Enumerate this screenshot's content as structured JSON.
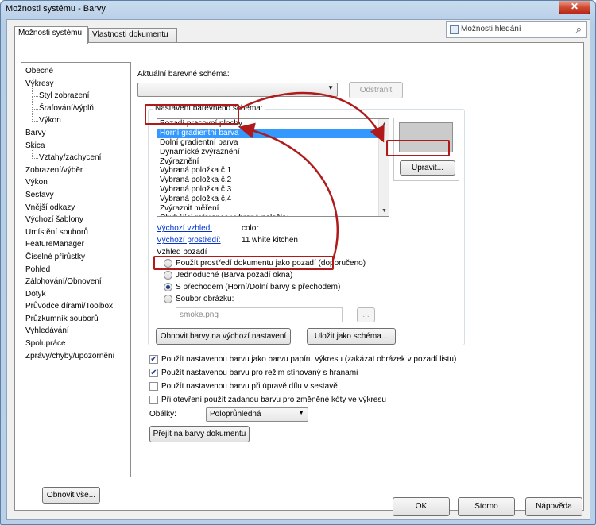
{
  "window": {
    "title": "Možnosti systému - Barvy",
    "close_label": "✕"
  },
  "tabs": [
    {
      "label": "Možnosti systému"
    },
    {
      "label": "Vlastnosti dokumentu"
    }
  ],
  "search": {
    "placeholder": "Možnosti hledání"
  },
  "tree": [
    {
      "label": "Obecné",
      "level": 1
    },
    {
      "label": "Výkresy",
      "level": 1
    },
    {
      "label": "Styl zobrazení",
      "level": 2
    },
    {
      "label": "Šrafování/výplň",
      "level": 2
    },
    {
      "label": "Výkon",
      "level": 2
    },
    {
      "label": "Barvy",
      "level": 1
    },
    {
      "label": "Skica",
      "level": 1
    },
    {
      "label": "Vztahy/zachycení",
      "level": 2
    },
    {
      "label": "Zobrazení/výběr",
      "level": 1
    },
    {
      "label": "Výkon",
      "level": 1
    },
    {
      "label": "Sestavy",
      "level": 1
    },
    {
      "label": "Vnější odkazy",
      "level": 1
    },
    {
      "label": "Výchozí šablony",
      "level": 1
    },
    {
      "label": "Umístění souborů",
      "level": 1
    },
    {
      "label": "FeatureManager",
      "level": 1
    },
    {
      "label": "Číselné přírůstky",
      "level": 1
    },
    {
      "label": "Pohled",
      "level": 1
    },
    {
      "label": "Zálohování/Obnovení",
      "level": 1
    },
    {
      "label": "Dotyk",
      "level": 1
    },
    {
      "label": "Průvodce dírami/Toolbox",
      "level": 1
    },
    {
      "label": "Průzkumník souborů",
      "level": 1
    },
    {
      "label": "Vyhledávání",
      "level": 1
    },
    {
      "label": "Spolupráce",
      "level": 1
    },
    {
      "label": "Zprávy/chyby/upozornění",
      "level": 1
    }
  ],
  "reset_all_label": "Obnovit vše...",
  "scheme": {
    "current_label": "Aktuální barevné schéma:",
    "current_value": "",
    "remove_label": "Odstranit",
    "settings_label": "Nastavení barevného schéma:",
    "items": [
      "Pozadí pracovní plochy",
      "Horní gradientní barva",
      "Dolní gradientní barva",
      "Dynamické zvýraznění",
      "Zvýraznění",
      "Vybraná položka č.1",
      "Vybraná položka č.2",
      "Vybraná položka č.3",
      "Vybraná položka č.4",
      "Zvýraznit měření",
      "Chybějící reference vybrané položky"
    ],
    "selected_index": 1,
    "edit_label": "Upravit...",
    "swatch_color": "#cbcbcb"
  },
  "appearance": {
    "default_look_label": "Výchozí vzhled:",
    "default_look_value": "color",
    "default_env_label": "Výchozí prostředí:",
    "default_env_value": "11 white kitchen"
  },
  "background": {
    "label": "Vzhled pozadí",
    "options": [
      {
        "label": "Použít prostředí dokumentu jako pozadí (doporučeno)",
        "selected": false
      },
      {
        "label": "Jednoduché (Barva pozadí okna)",
        "selected": false
      },
      {
        "label": "S přechodem (Horní/Dolní barvy s přechodem)",
        "selected": true
      },
      {
        "label": "Soubor obrázku:",
        "selected": false
      }
    ],
    "image_file": "smoke.png",
    "browse_label": "..."
  },
  "restore_defaults_label": "Obnovit barvy na výchozí nastavení",
  "save_scheme_label": "Uložit jako schéma...",
  "checkboxes": [
    {
      "label": "Použít nastavenou barvu jako barvu papíru výkresu (zakázat obrázek v pozadí listu)",
      "checked": true
    },
    {
      "label": "Použít nastavenou barvu pro režim stínovaný s hranami",
      "checked": true
    },
    {
      "label": "Použít nastavenou barvu při úpravě dílu v sestavě",
      "checked": false
    },
    {
      "label": "Při otevření použít zadanou barvu pro změněné kóty ve výkresu",
      "checked": false
    }
  ],
  "envelopes": {
    "label": "Obálky:",
    "value": "Poloprůhledná"
  },
  "goto_doc_colors_label": "Přejít na barvy dokumentu",
  "footer": {
    "ok_label": "OK",
    "cancel_label": "Storno",
    "help_label": "Nápověda"
  },
  "accent": {
    "annotation_red": "#b01a1a",
    "selection_blue": "#3399ff"
  }
}
